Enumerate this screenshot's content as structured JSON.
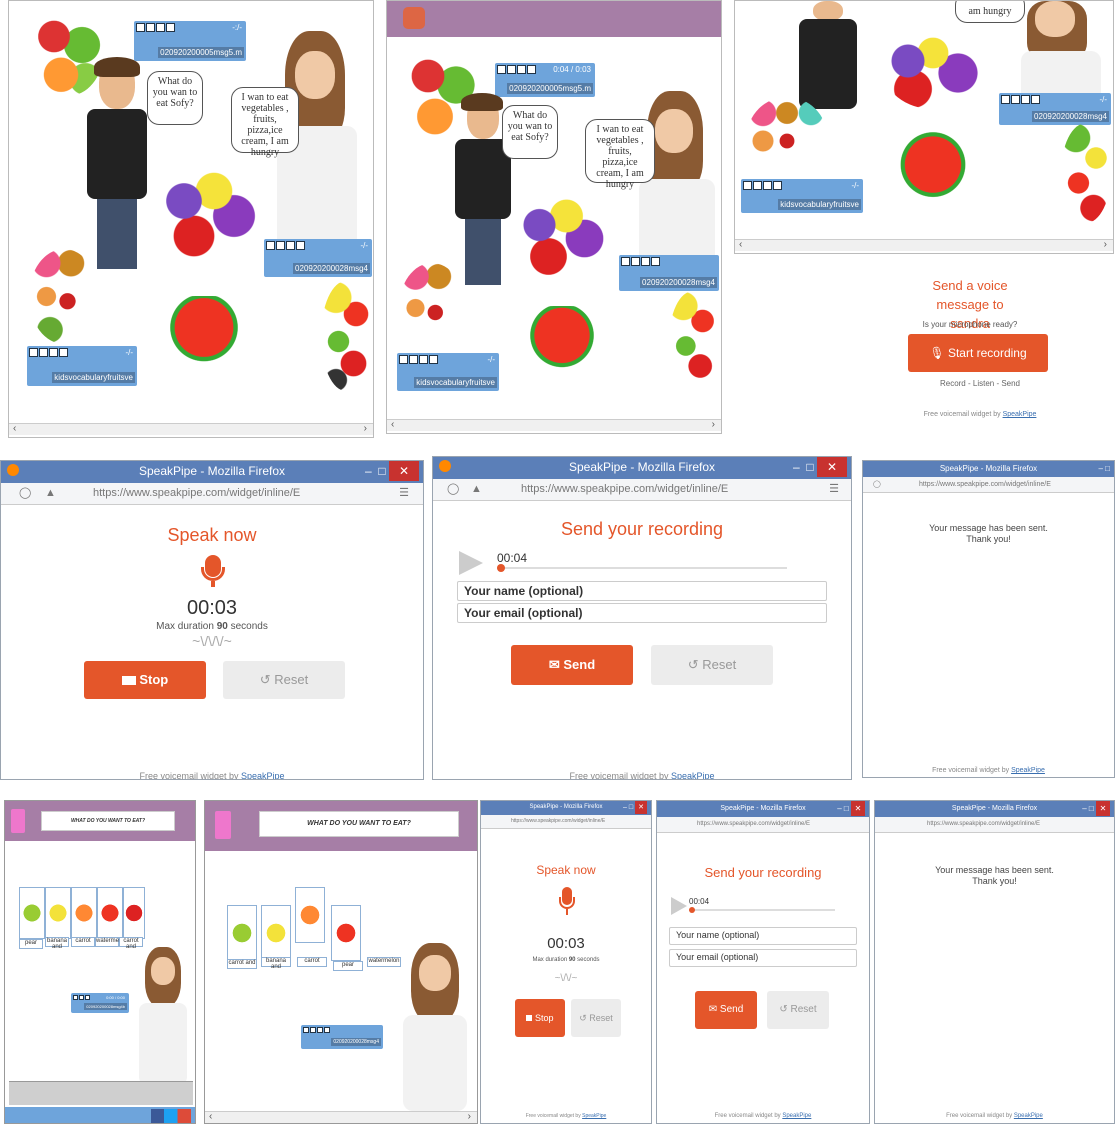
{
  "scene1": {
    "bubble_boy": "What do you wan to eat Sofy?",
    "bubble_girl": "I wan to eat vegetables , fruits, pizza,ice cream, I am hungry",
    "player_top_time": "-:/-",
    "player_top_file": "020920200005msg5.m",
    "player_right_time": "-/-",
    "player_right_file": "020920200028msg4",
    "player_left_time": "-/-",
    "player_left_file": "kidsvocabularyfruitsve"
  },
  "scene2": {
    "bubble_boy": "What do you wan to eat Sofy?",
    "bubble_girl": "I wan to eat vegetables , fruits, pizza,ice cream, I am hungry",
    "player_top_time": "0:04 / 0:03",
    "player_top_file": "020920200005msg5.m",
    "player_right_file": "020920200028msg4",
    "player_left_time": "-/-",
    "player_left_file": "kidsvocabularyfruitsve"
  },
  "scene3": {
    "bubble_girl": "am hungry",
    "player_right_time": "-/-",
    "player_right_file": "020920200028msg4",
    "player_left_time": "-/-",
    "player_left_file": "kidsvocabularyfruitsve",
    "send_title": "Send a voice message to sandra",
    "mic_question": "Is your microphone ready?",
    "start_button": "Start recording",
    "steps": "Record - Listen - Send",
    "footer_prefix": "Free voicemail widget by ",
    "footer_link": "SpeakPipe"
  },
  "browser": {
    "title": "SpeakPipe - Mozilla Firefox",
    "url": "https://www.speakpipe.com/widget/inline/E",
    "url_short": "https://www.speakpipe.com/widget/inline/E"
  },
  "speak_panel": {
    "heading": "Speak now",
    "timer": "00:03",
    "max_prefix": "Max duration ",
    "max_value": "90",
    "max_suffix": " seconds",
    "stop": "Stop",
    "reset": "Reset",
    "footer_prefix": "Free voicemail widget by ",
    "footer_link": "SpeakPipe"
  },
  "send_panel": {
    "heading": "Send your recording",
    "time": "00:04",
    "name_placeholder": "Your name (optional)",
    "email_placeholder": "Your email (optional)",
    "send": "Send",
    "reset": "Reset",
    "footer_prefix": "Free voicemail widget by ",
    "footer_link": "SpeakPipe"
  },
  "sent_panel": {
    "line1": "Your message has been sent.",
    "line2": "Thank you!",
    "footer_prefix": "Free voicemail widget by ",
    "footer_link": "SpeakPipe"
  },
  "quiz1": {
    "title": "WHAT DO YOU WANT TO EAT?",
    "labels": [
      "pear",
      "banana and",
      "carrot",
      "watermelon",
      "carrot and"
    ],
    "player_time": "0:00 / 0:00",
    "player_file": "020920200028msg4b"
  },
  "quiz2": {
    "title": "WHAT DO YOU WANT TO EAT?",
    "labels": [
      "carrot and",
      "banana and",
      "carrot",
      "pear",
      "watermelon"
    ],
    "player_file": "020920200028msg4"
  },
  "colors": {
    "accent": "#e4562a",
    "purple": "#a67ea6",
    "player_blue": "#6ea4db",
    "firefox_bar": "#5b7fb8"
  }
}
